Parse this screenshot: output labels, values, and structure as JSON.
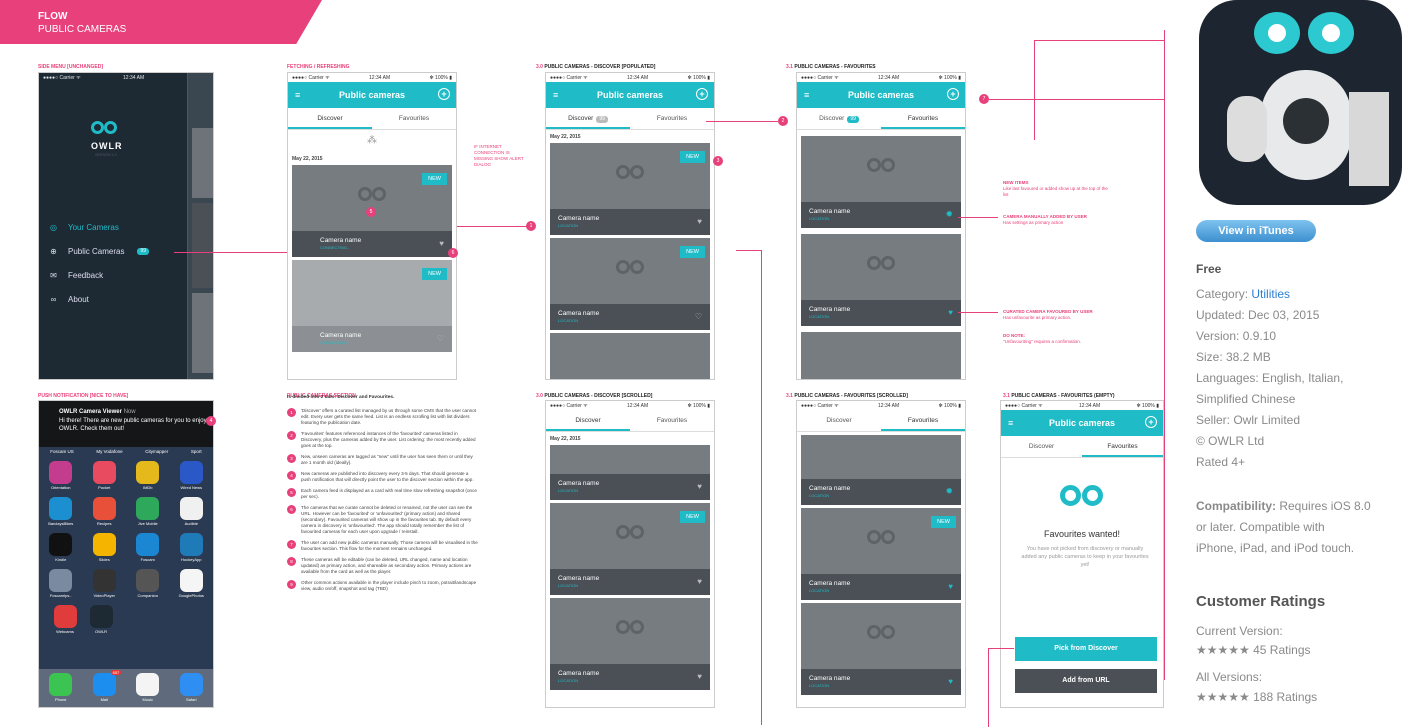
{
  "flow": {
    "title": "FLOW",
    "subtitle": "PUBLIC CAMERAS"
  },
  "sections": {
    "side_menu": "SIDE MENU [UNCHANGED]",
    "fetching": "FETCHING / REFRESHING",
    "discover_pop": "PUBLIC CAMERAS - DISCOVER [POPULATED]",
    "favs": "PUBLIC CAMERAS - FAVOURITES",
    "push": "PUSH NOTIFICATION [NICE TO HAVE]",
    "pc_section": "PUBLIC CAMERAS SECTION",
    "discover_scr": "PUBLIC CAMERAS - DISCOVER [SCROLLED]",
    "favs_scr": "PUBLIC CAMERAS - FAVOURITES [SCROLLED]",
    "favs_empty": "PUBLIC CAMERAS - FAVOURITES (EMPTY)",
    "n30": "3.0",
    "n31": "3.1"
  },
  "status": {
    "carrier": "●●●●○ Carrier ᯤ",
    "time": "12:34 AM",
    "battery": "✻ 100% ▮"
  },
  "app": {
    "title": "Public cameras",
    "tab_discover": "Discover",
    "tab_favourites": "Favourites",
    "badge": "99",
    "date": "May 22, 2015",
    "new": "NEW",
    "camera_name": "Camera name",
    "location": "LOCATION",
    "connecting": "CONNECTING..."
  },
  "side_menu": {
    "brand": "OWLR",
    "version": "VERSION 1.0",
    "items": [
      "Your Cameras",
      "Public Cameras",
      "Feedback",
      "About"
    ],
    "badge": "99",
    "peek_cam": "Cam",
    "peek_loc": "LOCA"
  },
  "notes": {
    "internet": "IF INTERNET CONNECTION IS MISSING SHOW ALERT DIALOG",
    "new_items_h": "NEW ITEMS",
    "new_items_b": "Like last favoured or added show up at the top of the list",
    "manual_h": "CAMERA MANUALLY ADDED BY USER",
    "manual_b": "Has settings as primary action",
    "curated_h": "CURATED CAMERA FAVOURED BY USER",
    "curated_b": "Has unfavourite as primary action.",
    "donote_h": "DO NOTE:",
    "donote_b": "\"Unfavouriting\" requires a confirmation."
  },
  "push": {
    "app": "OWLR Camera Viewer",
    "time": "Now",
    "message": "Hi there! There are new public cameras for you to enjoy in OWLR. Check them out!",
    "apps": [
      [
        "Orientation",
        "Pocket",
        "IMDb",
        "Wired News"
      ],
      [
        "BarclaysBikes",
        "Recipes",
        "Jive Mobile",
        "Audible"
      ],
      [
        "Kindle",
        "Slides",
        "Foscam",
        "HockeyApp"
      ],
      [
        "FoscamIps..",
        "VideoPlayer",
        "Companion",
        "GooglePhotos"
      ],
      [
        "Webcams",
        "OWLR",
        "",
        ""
      ]
    ],
    "top": [
      "Foscam US",
      "My Vodafone",
      "Citymapper",
      "Sport"
    ],
    "dock": [
      "Phone",
      "Mail",
      "Music",
      "Safari"
    ],
    "mail_badge": "657"
  },
  "pc_section": {
    "intro": "Is divided into 2 tabs: Discover and Favourites.",
    "steps": [
      "'Discover' offers a curated list managed by us through some CMS that the user cannot edit. Every user gets the same feed. List is an endless scrolling list with list dividers featuring the publication date.",
      "'Favourites' features referenced instances of the 'favourited' cameras listed in Discovery, plus the cameras added by the user. List ordering: the most recently added goes at the top.",
      "New, unseen cameras are tagged as \"new\" until the user has seen them or until they are 1 month old (ideally).",
      "New cameras are published into discovery every 3-5 days. That should generate a push notification that will directly point the user to the discover section within the app.",
      "Each camera feed is displayed as a card with real time slow refreshing snapshot (once per sec).",
      "The cameras that we curate cannot be deleted or renamed, not the user can see the URL. However can be 'favourited' or 'unfavourited' (primary action) and shared (secondary). Favourited cameras will show up in the favourites tab. By default every camera in discovery is 'unfavourited'. The app should totally remember the list of favourited cameras for each user upon upgrade / reinstall.",
      "The user can add new public cameras manually. Those camera will be visualised in the favourites section. This flow for the moment remains unchanged.",
      "These cameras will be editable (can be deleted, URL changed, name and location updated) as primary action, and shareable as secondary action. Primary actions are available from the card as well as the player.",
      "Other common actions available in the player include pinch to zoom, potrait/landscape view, audio on/off, snapshot and tag (TBD)"
    ]
  },
  "empty": {
    "title": "Favourites wanted!",
    "body": "You have not picked from discovery or manually added any public cameras to keep in your favourites yet!",
    "pick": "Pick from Discover",
    "add": "Add from URL"
  },
  "itunes": {
    "button": "View in iTunes",
    "price": "Free",
    "category_label": "Category:",
    "category": "Utilities",
    "updated": "Updated: Dec 03, 2015",
    "version": "Version: 0.9.10",
    "size": "Size: 38.2 MB",
    "languages1": "Languages: English, Italian,",
    "languages2": "Simplified Chinese",
    "seller": "Seller: Owlr Limited",
    "copyright": "© OWLR Ltd",
    "rated": "Rated 4+",
    "compat_label": "Compatibility:",
    "compat1": " Requires iOS 8.0",
    "compat2": "or later. Compatible with",
    "compat3": "iPhone, iPad, and iPod touch.",
    "ratings_h": "Customer Ratings",
    "current": "Current Version:",
    "current_r": "★★★★★ 45 Ratings",
    "all": "All Versions:",
    "all_r": "★★★★★ 188 Ratings"
  },
  "colors": {
    "accent": "#1fbcc8",
    "pink": "#e8407a",
    "dark": "#1d2a34"
  }
}
